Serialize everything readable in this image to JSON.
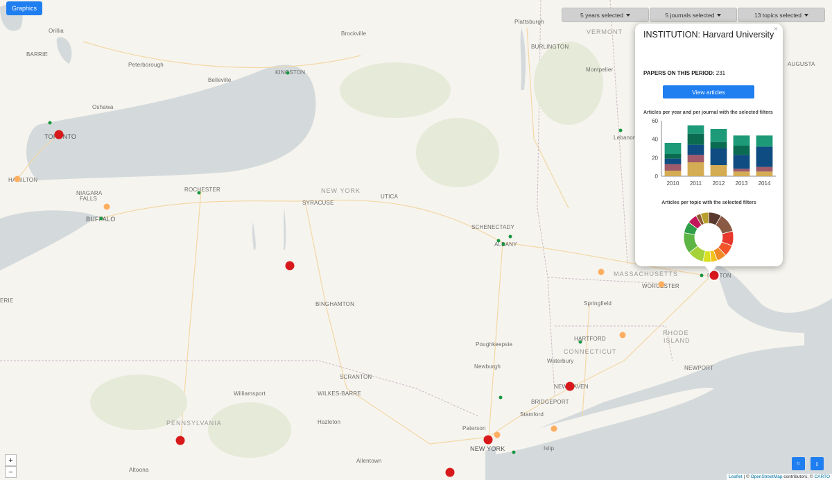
{
  "toolbar": {
    "graphics_label": "Graphics",
    "filters": [
      {
        "label": "5 years selected"
      },
      {
        "label": "5 journals selected"
      },
      {
        "label": "13 topics selected"
      }
    ]
  },
  "map": {
    "labels": {
      "vermont": "VERMONT",
      "new_york": "NEW YORK",
      "massachusetts": "MASSACHUSETTS",
      "connecticut": "CONNECTICUT",
      "rhode_island_1": "RHODE",
      "rhode_island_2": "ISLAND",
      "pennsylvania": "PENNSYLVANIA",
      "toronto": "TORONTO",
      "hamilton": "HAMILTON",
      "niagara_1": "NIAGARA",
      "niagara_2": "FALLS",
      "buffalo": "BUFFALO",
      "rochester": "ROCHESTER",
      "syracuse": "SYRACUSE",
      "utica": "UTICA",
      "schenectady": "SCHENECTADY",
      "albany": "ALBANY",
      "binghamton": "BINGHAMTON",
      "scranton": "SCRANTON",
      "wilkes_barre": "WILKES-BARRE",
      "williamsport": "Williamsport",
      "hazleton": "Hazleton",
      "allentown": "Allentown",
      "altoona": "Altoona",
      "kingston": "KINGSTON",
      "brockville": "Brockville",
      "belleville": "Belleville",
      "peterborough": "Peterborough",
      "oshawa": "Oshawa",
      "orillia": "Orillia",
      "barrie": "BARRIE",
      "plattsburgh": "Plattsburgh",
      "burlington": "BURLINGTON",
      "montpelier": "Montpelier",
      "augusta": "AUGUSTA",
      "lebanon": "Lebanon",
      "worcester": "WORCESTER",
      "springfield": "Springfield",
      "hartford": "HARTFORD",
      "waterbury": "Waterbury",
      "new_haven": "NEW HAVEN",
      "bridgeport": "BRIDGEPORT",
      "stamford": "Stamford",
      "newport": "NEWPORT",
      "poughkeepsie": "Poughkeepsie",
      "newburgh": "Newburgh",
      "paterson": "Paterson",
      "new_york_city": "NEW YORK",
      "islip": "Islip",
      "boston": "BOSTON",
      "erie": "ERIE"
    }
  },
  "popup": {
    "title": "INSTITUTION: Harvard University",
    "papers_label": "PAPERS ON THIS PERIOD:",
    "papers_value": "231",
    "view_button": "View articles",
    "bar_title": "Articles per year and per journal with the selected filters",
    "donut_title": "Articles per topic with the selected filters",
    "close": "×"
  },
  "chart_data": [
    {
      "type": "bar",
      "title": "Articles per year and per journal with the selected filters",
      "categories": [
        "2010",
        "2011",
        "2012",
        "2013",
        "2014"
      ],
      "ylim": [
        0,
        60
      ],
      "yticks": [
        0,
        20,
        40,
        60
      ],
      "stacked": true,
      "series": [
        {
          "values": [
            6,
            15,
            12,
            5,
            5
          ],
          "color": "#d4ac54"
        },
        {
          "values": [
            7,
            8,
            0,
            3,
            5
          ],
          "color": "#a05a6a"
        },
        {
          "values": [
            6,
            11,
            18,
            15,
            22
          ],
          "color": "#0f4c81"
        },
        {
          "values": [
            5,
            12,
            7,
            10,
            0
          ],
          "color": "#0b6b50"
        },
        {
          "values": [
            12,
            9,
            14,
            11,
            12
          ],
          "color": "#1d9a78"
        }
      ]
    },
    {
      "type": "pie",
      "title": "Articles per topic with the selected filters",
      "donut": true,
      "values": [
        8,
        12,
        9,
        7,
        6,
        4,
        5,
        10,
        13,
        7,
        6,
        3,
        5
      ],
      "colors": [
        "#5a3a2e",
        "#8a5a44",
        "#e8372c",
        "#f2552a",
        "#f08a24",
        "#f4c21d",
        "#d9e021",
        "#a6d23a",
        "#5cb544",
        "#2e9e48",
        "#c2185b",
        "#8e5a30",
        "#b8a030"
      ]
    }
  ],
  "controls": {
    "zoom_in": "+",
    "zoom_out": "−",
    "square_1": "⚐",
    "square_2": "▯"
  },
  "attribution": {
    "leaflet": "Leaflet",
    "osm": "OpenStreetMap",
    "contributors": "contributors,",
    "carto": "CARTO"
  }
}
